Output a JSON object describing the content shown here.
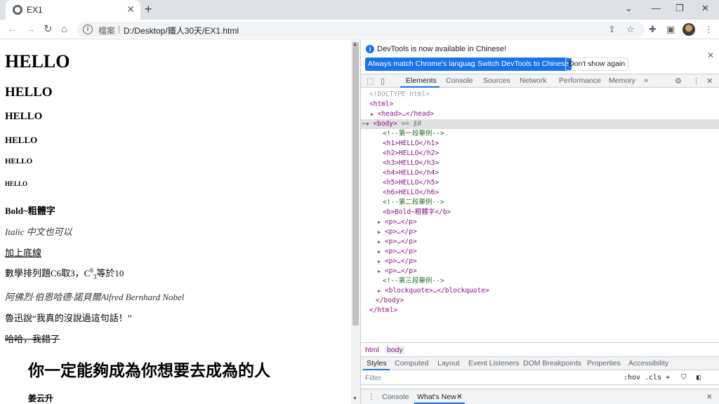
{
  "browser": {
    "tab_title": "EX1",
    "url_scheme_label": "檔案",
    "url": "D:/Desktop/鐵人30天/EX1.html"
  },
  "page": {
    "h1": "HELLO",
    "h2": "HELLO",
    "h3": "HELLO",
    "h4": "HELLO",
    "h5": "HELLO",
    "h6": "HELLO",
    "bold": "Bold~粗體字",
    "italic": "Italic 中文也可以",
    "underline": "加上底線",
    "math_prefix": "數學排列題C6取3，C",
    "math_sup": "6",
    "math_sub": "3",
    "math_suffix": "等於10",
    "name": "阿佛烈·伯恩哈德·諾貝爾Alfred Bernhard Nobel",
    "quote": "魯迅說“我真的沒說過這句話！”",
    "strike": "哈哈，我錯了",
    "blockquote_title": "你一定能夠成為你想要去成為的人",
    "blockquote_author": "姜云升"
  },
  "devtools": {
    "info_text": "DevTools is now available in Chinese!",
    "btn_match": "Always match Chrome's language",
    "btn_switch": "Switch DevTools to Chinese",
    "btn_dont": "Don't show again",
    "tabs": [
      "Elements",
      "Console",
      "Sources",
      "Network",
      "Performance",
      "Memory"
    ],
    "tree": {
      "doctype": "<!DOCTYPE html>",
      "html_open": "<html>",
      "head": "<head>…</head>",
      "body_open": "<body>",
      "body_eq": "== $0",
      "comment1": "<!--第一段舉例-->",
      "h1": "<h1>HELLO</h1>",
      "h2": "<h2>HELLO</h2>",
      "h3": "<h3>HELLO</h3>",
      "h4": "<h4>HELLO</h4>",
      "h5": "<h5>HELLO</h5>",
      "h6": "<h6>HELLO</h6>",
      "comment2": "<!--第二段舉例-->",
      "b": "<b>Bold~粗體字</b>",
      "p": "<p>…</p>",
      "comment3": "<!--第三段舉例-->",
      "blockquote": "<blockquote>…</blockquote>",
      "body_close": "</body>",
      "html_close": "</html>"
    },
    "breadcrumbs": [
      "html",
      "body"
    ],
    "style_tabs": [
      "Styles",
      "Computed",
      "Layout",
      "Event Listeners",
      "DOM Breakpoints",
      "Properties",
      "Accessibility"
    ],
    "filter_placeholder": "Filter",
    "filter_hov": ":hov",
    "filter_cls": ".cls",
    "drawer_tabs": [
      "Console",
      "What's New"
    ]
  }
}
